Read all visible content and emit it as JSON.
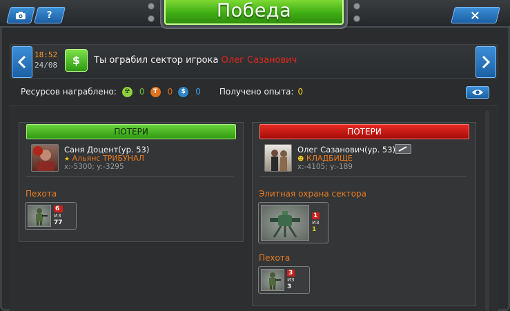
{
  "header": {
    "title": "Победа",
    "camera_icon": "camera-icon",
    "help_label": "?",
    "close_label": "×"
  },
  "event": {
    "time": "18:52",
    "date": "24/08",
    "icon_label": "$",
    "message": "Ты ограбил сектор игрока",
    "player": "Олег Сазанович"
  },
  "resources": {
    "label": "Ресурсов награблено:",
    "items": [
      {
        "icon": "nuke-icon",
        "symbol": "☢",
        "value": "0",
        "color": "#6fc63a"
      },
      {
        "icon": "titanium-icon",
        "symbol": "T",
        "value": "0",
        "color": "#e6741d"
      },
      {
        "icon": "money-icon",
        "symbol": "$",
        "value": "0",
        "color": "#3ba3e6"
      }
    ],
    "experience_label": "Получено опыта:",
    "experience_value": "0"
  },
  "left_panel": {
    "header": "ПОТЕРИ",
    "player": {
      "name": "Саня Доцент(ур. 53)",
      "alliance_icon": "star-icon",
      "alliance": "Альянс ТРИБУНАЛ",
      "coords": "x:-5300; y:-3295"
    },
    "sections": [
      {
        "label": "Пехота",
        "units": [
          {
            "lost": "6",
            "of": "из",
            "total": "77"
          }
        ]
      }
    ]
  },
  "right_panel": {
    "header": "ПОТЕРИ",
    "player": {
      "name": "Олег Сазанович(ур. 53)",
      "alliance_icon": "skull-icon",
      "alliance": "КЛАДБИЩЕ",
      "coords": "x:-4105; y:-189"
    },
    "sections": [
      {
        "label": "Элитная охрана сектора",
        "units": [
          {
            "lost": "1",
            "of": "из",
            "total": "1"
          }
        ]
      },
      {
        "label": "Пехота",
        "units": [
          {
            "lost": "3",
            "of": "из",
            "total": "3"
          }
        ]
      }
    ]
  }
}
